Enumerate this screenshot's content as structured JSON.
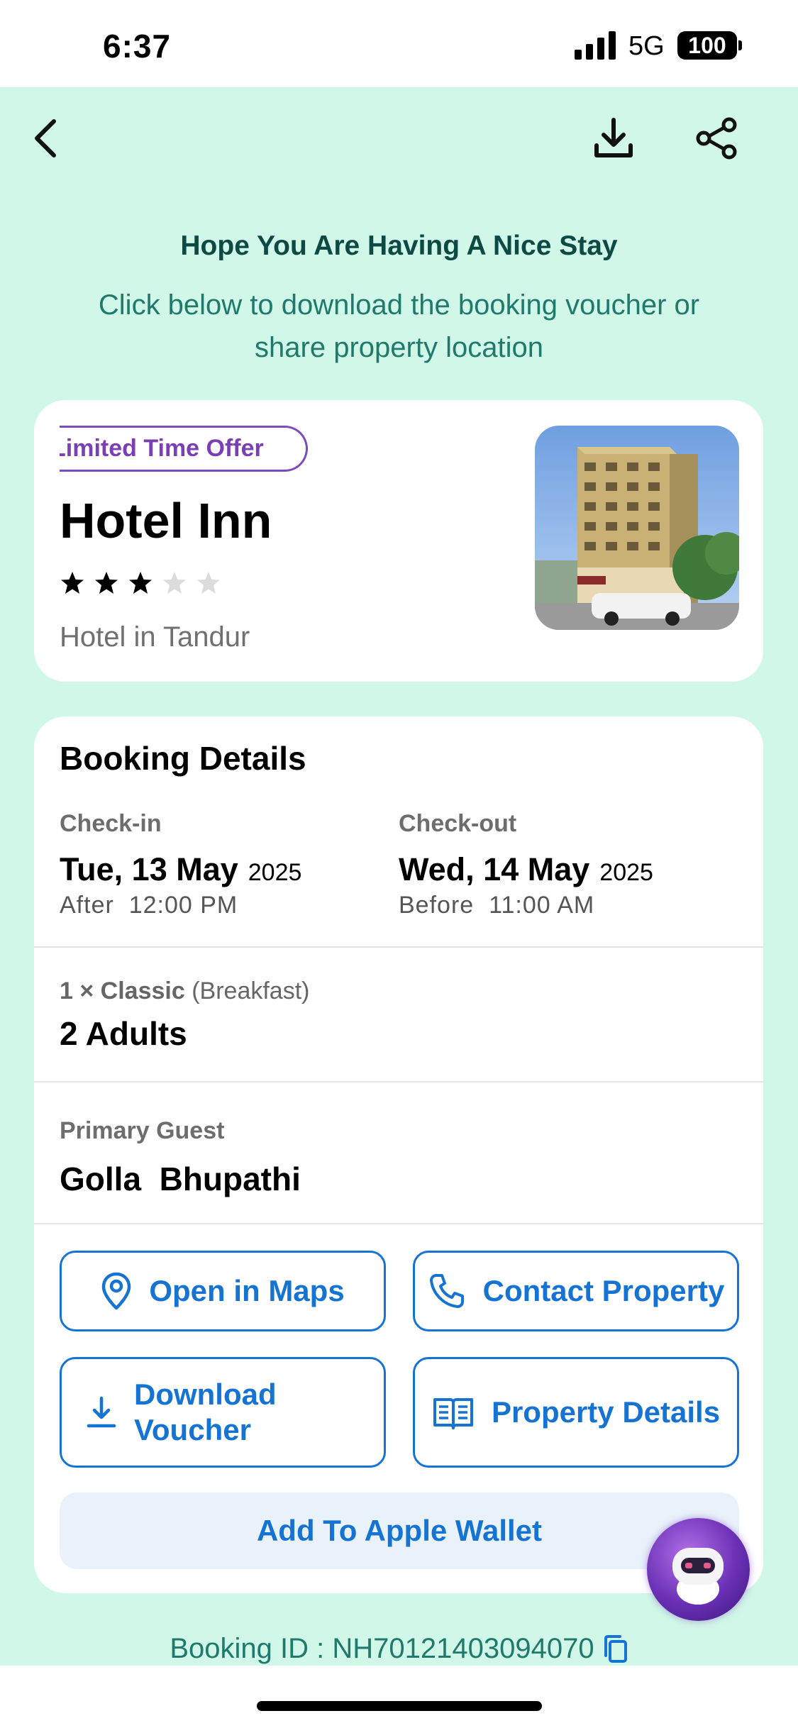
{
  "status_bar": {
    "time": "6:37",
    "network": "5G",
    "battery": "100"
  },
  "header": {
    "back_icon": "chevron-left-icon",
    "download_icon": "download-icon",
    "share_icon": "share-icon"
  },
  "intro": {
    "headline": "Hope You Are Having A Nice Stay",
    "subline": "Click below to download the booking voucher or share property location"
  },
  "hotel": {
    "offer_badge": "Limited Time Offer",
    "name": "Hotel Inn",
    "rating": 3,
    "max_rating": 5,
    "location": "Hotel in Tandur"
  },
  "booking": {
    "title": "Booking Details",
    "checkin": {
      "label": "Check-in",
      "date": "Tue, 13 May",
      "year": "2025",
      "time_prefix": "After",
      "time": "12:00 PM"
    },
    "checkout": {
      "label": "Check-out",
      "date": "Wed, 14 May",
      "year": "2025",
      "time_prefix": "Before",
      "time": "11:00 AM"
    },
    "room_qty": "1 ×",
    "room_type": "Classic",
    "room_plan": "(Breakfast)",
    "guests": "2 Adults",
    "primary_guest_label": "Primary Guest",
    "primary_guest_name": "Golla  Bhupathi"
  },
  "actions": {
    "open_maps": "Open in Maps",
    "contact_property": "Contact Property",
    "download_voucher": "Download Voucher",
    "property_details": "Property Details",
    "apple_wallet": "Add To Apple Wallet"
  },
  "footer": {
    "booking_id": "Booking ID : NH70121403094070"
  },
  "colors": {
    "background": "#d1f7e8",
    "accent": "#1574d3",
    "headline": "#0d4a45",
    "offer": "#7b3fb5"
  }
}
